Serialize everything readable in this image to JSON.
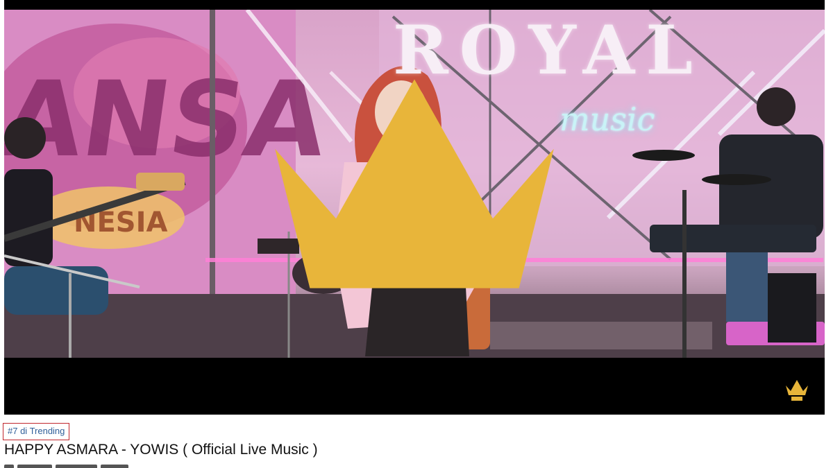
{
  "player": {
    "backdrop_brand": "ROYAL",
    "backdrop_subtitle": "music",
    "watermark_icon": "royal-crown-logo-icon"
  },
  "video": {
    "trending_badge": "#7 di Trending",
    "title": "HAPPY ASMARA - YOWIS ( Official Live Music )"
  },
  "colors": {
    "badge_border": "#c0262d",
    "badge_text": "#2f5f99",
    "title_text": "#111111",
    "crown_gold": "#e8b53a"
  }
}
